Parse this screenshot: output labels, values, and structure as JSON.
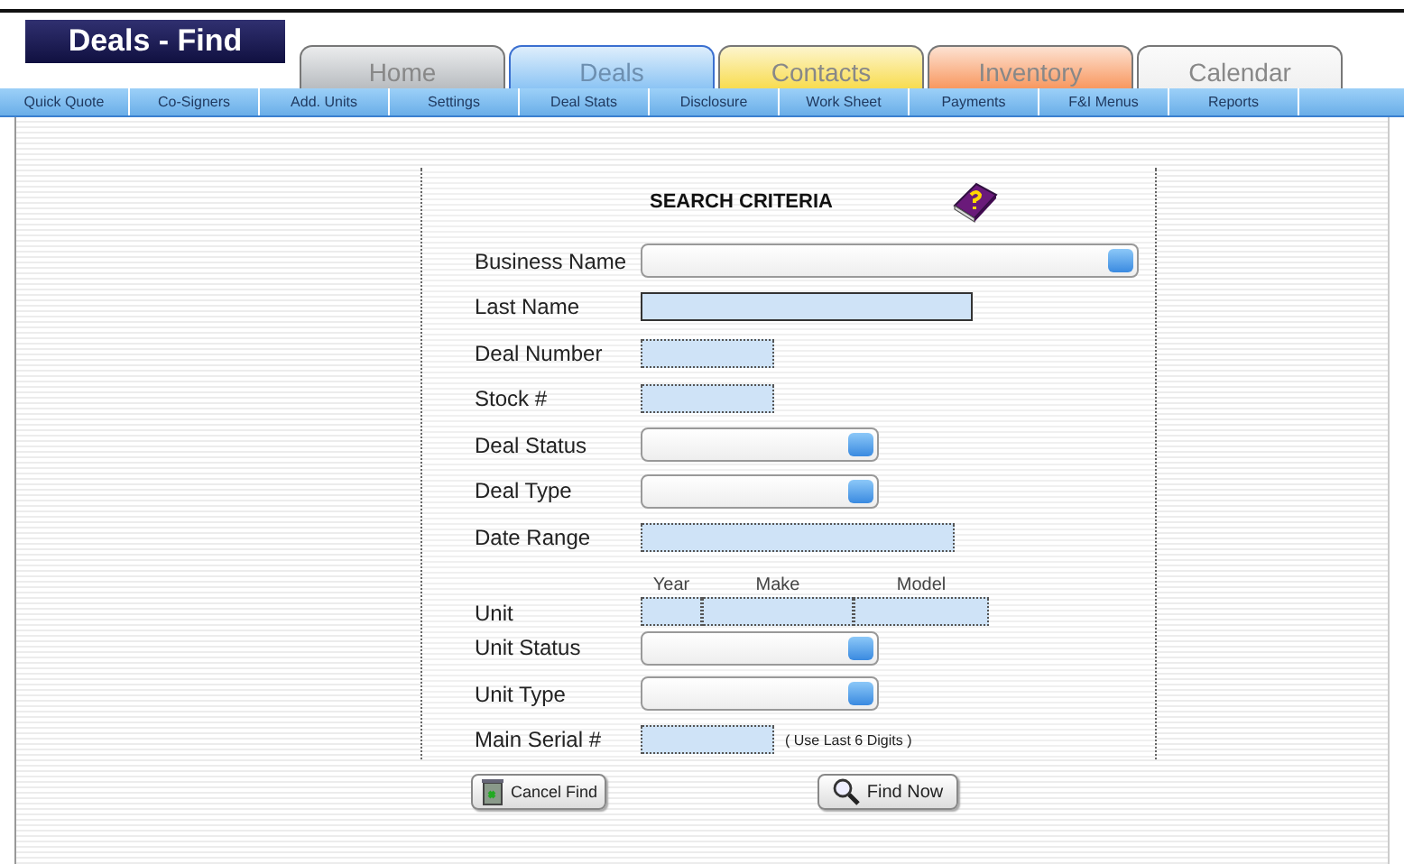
{
  "page_title": "Deals - Find",
  "tabs": [
    {
      "label": "Home",
      "selected": false,
      "color": "#b8bcc0"
    },
    {
      "label": "Deals",
      "selected": true,
      "color": "#8cc4f4"
    },
    {
      "label": "Contacts",
      "selected": false,
      "color": "#f8dc50"
    },
    {
      "label": "Inventory",
      "selected": false,
      "color": "#f89860"
    },
    {
      "label": "Calendar",
      "selected": false,
      "color": "#f0f0f0"
    }
  ],
  "subnav": [
    "Quick Quote",
    "Co-Signers",
    "Add. Units",
    "Settings",
    "Deal Stats",
    "Disclosure",
    "Work Sheet",
    "Payments",
    "F&I Menus",
    "Reports"
  ],
  "form": {
    "title": "SEARCH CRITERIA",
    "fields": [
      {
        "label": "Business Name",
        "kind": "select"
      },
      {
        "label": "Last Name",
        "kind": "text"
      },
      {
        "label": "Deal Number",
        "kind": "text"
      },
      {
        "label": "Stock #",
        "kind": "text"
      },
      {
        "label": "Deal Status",
        "kind": "select"
      },
      {
        "label": "Deal Type",
        "kind": "select"
      },
      {
        "label": "Date Range",
        "kind": "text"
      },
      {
        "label": "Unit",
        "kind": "unit",
        "parts": [
          "Year",
          "Make",
          "Model"
        ]
      },
      {
        "label": "Unit Status",
        "kind": "select"
      },
      {
        "label": "Unit Type",
        "kind": "select"
      },
      {
        "label": "Main Serial #",
        "kind": "text",
        "note": "( Use Last 6 Digits )"
      }
    ]
  },
  "buttons": [
    {
      "label": "Cancel Find",
      "kind": "cancel"
    },
    {
      "label": "Find Now",
      "kind": "find"
    }
  ]
}
